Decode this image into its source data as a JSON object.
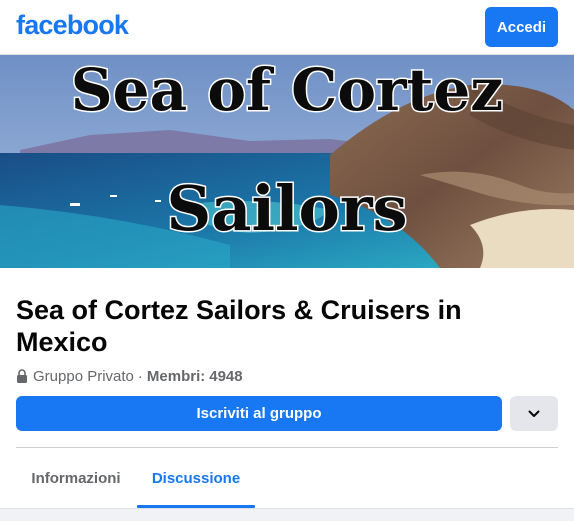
{
  "header": {
    "logo": "facebook",
    "login_label": "Accedi"
  },
  "cover": {
    "title_line1": "Sea of Cortez",
    "title_line2": "Sailors"
  },
  "group": {
    "name": "Sea of Cortez Sailors & Cruisers in Mexico",
    "privacy": "Gruppo Privato",
    "separator": "·",
    "members_label": "Membri:",
    "members_count": "4948"
  },
  "actions": {
    "join_label": "Iscriviti al gruppo"
  },
  "tabs": [
    {
      "label": "Informazioni",
      "active": false
    },
    {
      "label": "Discussione",
      "active": true
    }
  ],
  "colors": {
    "brand": "#1877f2",
    "secondary_text": "#65676b",
    "button_gray": "#e4e6eb"
  },
  "icons": {
    "privacy": "lock-icon",
    "more": "chevron-down-icon"
  }
}
